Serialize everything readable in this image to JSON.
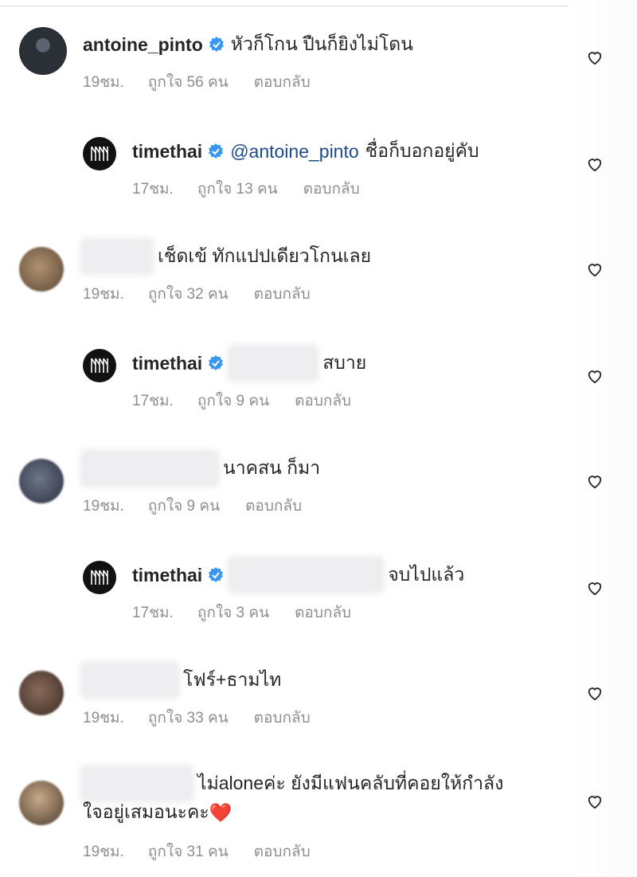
{
  "comments": [
    {
      "username": "antoine_pinto",
      "verified": true,
      "text": "หัวก็โกน ปืนก็ยิงไม่โดน",
      "time": "19ชม.",
      "likes": "ถูกใจ 56 คน",
      "reply": "ตอบกลับ"
    },
    {
      "username": "timethai",
      "verified": true,
      "mention": "@antoine_pinto",
      "text": "ชื่อก็บอกอยู่คับ",
      "time": "17ชม.",
      "likes": "ถูกใจ 13 คน",
      "reply": "ตอบกลับ"
    },
    {
      "text": "เช็ดเข้ ทักแปปเดียวโกนเลย",
      "time": "19ชม.",
      "likes": "ถูกใจ 32 คน",
      "reply": "ตอบกลับ"
    },
    {
      "username": "timethai",
      "verified": true,
      "text": "สบาย",
      "time": "17ชม.",
      "likes": "ถูกใจ 9 คน",
      "reply": "ตอบกลับ"
    },
    {
      "text": "นาคสน ก็มา",
      "time": "19ชม.",
      "likes": "ถูกใจ 9 คน",
      "reply": "ตอบกลับ"
    },
    {
      "username": "timethai",
      "verified": true,
      "text": "จบไปแล้ว",
      "time": "17ชม.",
      "likes": "ถูกใจ 3 คน",
      "reply": "ตอบกลับ"
    },
    {
      "text": "โฟร์+ธามไท",
      "time": "19ชม.",
      "likes": "ถูกใจ 33 คน",
      "reply": "ตอบกลับ"
    },
    {
      "text": "ไม่aloneค่ะ ยังมีแฟนคลับที่คอยให้กำลัง",
      "text2": "ใจอยู่เสมอนะคะ",
      "emoji": "❤️",
      "time": "19ชม.",
      "likes": "ถูกใจ 31 คน",
      "reply": "ตอบกลับ"
    }
  ],
  "icons": {
    "like": "heart-outline-icon",
    "verified": "verified-badge-icon"
  },
  "colors": {
    "verified": "#3897f0",
    "mention": "#1e4a8a",
    "meta": "#8e8e8e"
  }
}
